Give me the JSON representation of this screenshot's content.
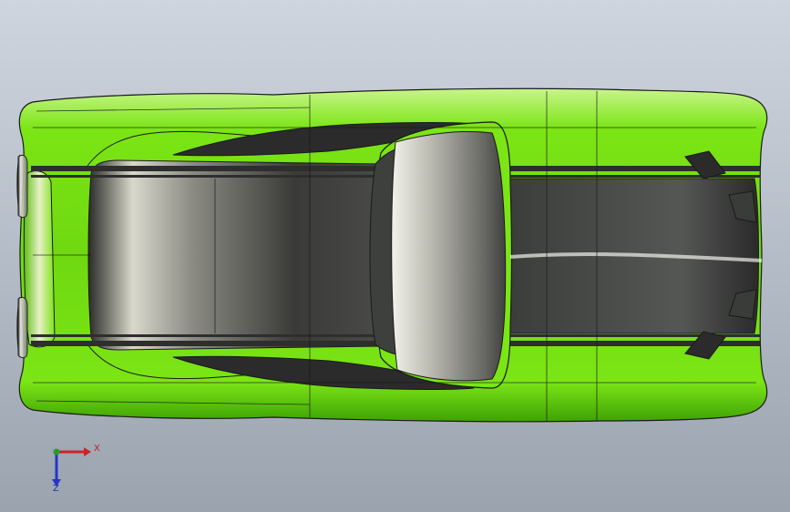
{
  "viewport": {
    "background_top": "#cfd5de",
    "background_bottom": "#9aa3ae"
  },
  "model": {
    "body_color": "#7be515",
    "body_shadow_color": "#3fa205",
    "stripe_color": "#3a3c3a",
    "glass_color": "#5c5e5c",
    "edge_color": "#1a1a1a"
  },
  "triad": {
    "x_label": "X",
    "z_label": "Z",
    "x_color": "#d0202a",
    "y_color": "#2a9a2a",
    "z_color": "#2535c8"
  }
}
